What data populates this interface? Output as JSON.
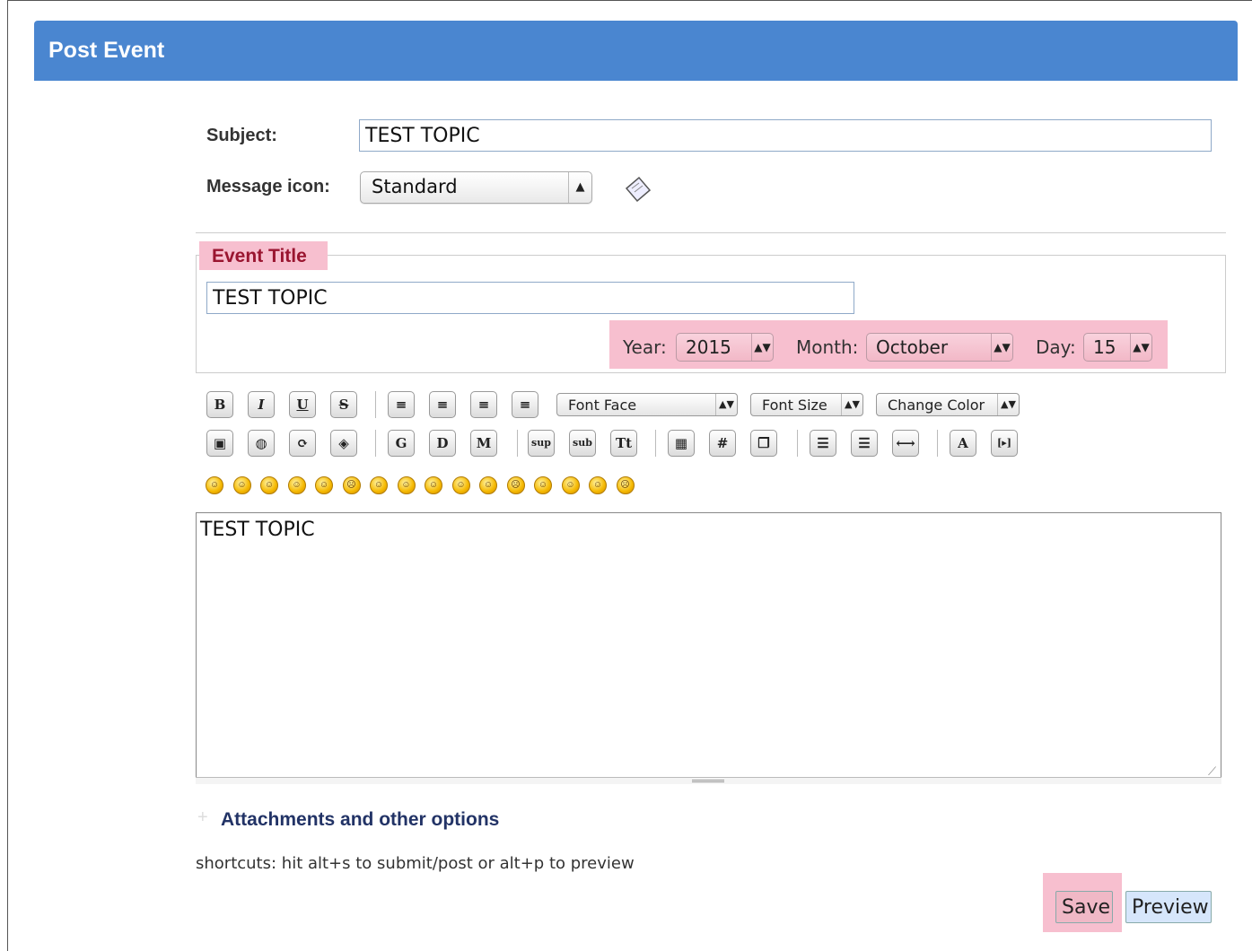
{
  "window": {
    "title": "Post Event"
  },
  "form": {
    "subject_label": "Subject:",
    "subject_value": "TEST TOPIC",
    "message_icon_label": "Message icon:",
    "message_icon_value": "Standard"
  },
  "event": {
    "legend": "Event Title",
    "title_value": "TEST TOPIC",
    "year_label": "Year:",
    "year_value": "2015",
    "month_label": "Month:",
    "month_value": "October",
    "day_label": "Day:",
    "day_value": "15"
  },
  "toolbar": {
    "row1": [
      {
        "name": "bold-button",
        "glyph": "B"
      },
      {
        "name": "italic-button",
        "glyph": "I"
      },
      {
        "name": "underline-button",
        "glyph": "U"
      },
      {
        "name": "strikethrough-button",
        "glyph": "S"
      },
      {
        "name": "align-left-button",
        "glyph": "≡"
      },
      {
        "name": "align-justify-button",
        "glyph": "≡"
      },
      {
        "name": "align-center-button",
        "glyph": "≡"
      },
      {
        "name": "align-right-button",
        "glyph": "≡"
      }
    ],
    "font_face": "Font Face",
    "font_size": "Font Size",
    "change_color": "Change Color",
    "row2": [
      {
        "name": "insert-image-button",
        "glyph": "▣"
      },
      {
        "name": "insert-link-button",
        "glyph": "◍"
      },
      {
        "name": "insert-email-button",
        "glyph": "⟳"
      },
      {
        "name": "insert-ftp-button",
        "glyph": "◈"
      },
      {
        "name": "google-button",
        "glyph": "G"
      },
      {
        "name": "definition-button",
        "glyph": "D"
      },
      {
        "name": "marquee-button",
        "glyph": "M"
      },
      {
        "name": "superscript-button",
        "glyph": "sup"
      },
      {
        "name": "subscript-button",
        "glyph": "sub"
      },
      {
        "name": "teletype-button",
        "glyph": "Tt"
      },
      {
        "name": "insert-table-button",
        "glyph": "▦"
      },
      {
        "name": "insert-code-button",
        "glyph": "#"
      },
      {
        "name": "insert-quote-button",
        "glyph": "❐"
      },
      {
        "name": "bulleted-list-button",
        "glyph": "☰"
      },
      {
        "name": "numbered-list-button",
        "glyph": "☰"
      },
      {
        "name": "horizontal-rule-button",
        "glyph": "⟷"
      },
      {
        "name": "remove-format-button",
        "glyph": "A"
      },
      {
        "name": "toggle-view-button",
        "glyph": "[▸]"
      }
    ],
    "smileys": [
      "☺",
      "☺",
      "☺",
      "☺",
      "☺",
      "☹",
      "☺",
      "☺",
      "☺",
      "☺",
      "☺",
      "☹",
      "☺",
      "☺",
      "☺",
      "☹"
    ]
  },
  "editor": {
    "text": "TEST TOPIC"
  },
  "options": {
    "attachments_label": "Attachments and other options"
  },
  "footer": {
    "shortcut_text": "shortcuts: hit alt+s to submit/post or alt+p to preview",
    "save_label": "Save",
    "preview_label": "Preview"
  }
}
